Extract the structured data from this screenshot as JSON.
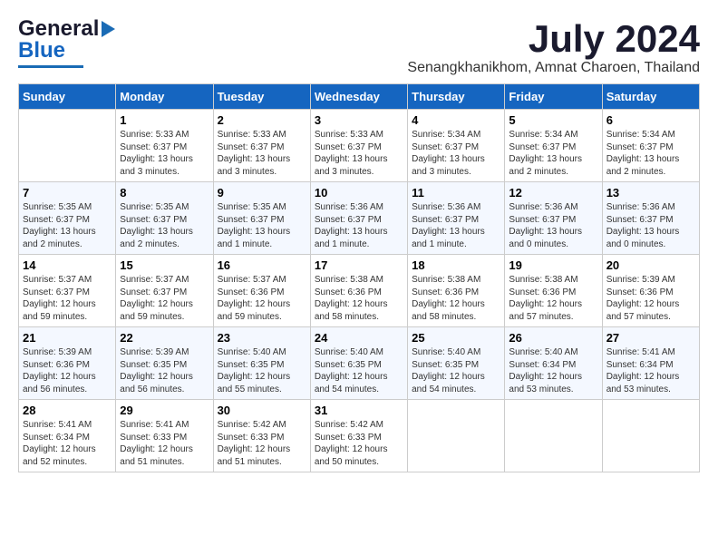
{
  "header": {
    "logo_line1": "General",
    "logo_line2": "Blue",
    "month": "July 2024",
    "location": "Senangkhanikhom, Amnat Charoen, Thailand"
  },
  "weekdays": [
    "Sunday",
    "Monday",
    "Tuesday",
    "Wednesday",
    "Thursday",
    "Friday",
    "Saturday"
  ],
  "weeks": [
    [
      {
        "day": "",
        "info": ""
      },
      {
        "day": "1",
        "info": "Sunrise: 5:33 AM\nSunset: 6:37 PM\nDaylight: 13 hours\nand 3 minutes."
      },
      {
        "day": "2",
        "info": "Sunrise: 5:33 AM\nSunset: 6:37 PM\nDaylight: 13 hours\nand 3 minutes."
      },
      {
        "day": "3",
        "info": "Sunrise: 5:33 AM\nSunset: 6:37 PM\nDaylight: 13 hours\nand 3 minutes."
      },
      {
        "day": "4",
        "info": "Sunrise: 5:34 AM\nSunset: 6:37 PM\nDaylight: 13 hours\nand 3 minutes."
      },
      {
        "day": "5",
        "info": "Sunrise: 5:34 AM\nSunset: 6:37 PM\nDaylight: 13 hours\nand 2 minutes."
      },
      {
        "day": "6",
        "info": "Sunrise: 5:34 AM\nSunset: 6:37 PM\nDaylight: 13 hours\nand 2 minutes."
      }
    ],
    [
      {
        "day": "7",
        "info": "Sunrise: 5:35 AM\nSunset: 6:37 PM\nDaylight: 13 hours\nand 2 minutes."
      },
      {
        "day": "8",
        "info": "Sunrise: 5:35 AM\nSunset: 6:37 PM\nDaylight: 13 hours\nand 2 minutes."
      },
      {
        "day": "9",
        "info": "Sunrise: 5:35 AM\nSunset: 6:37 PM\nDaylight: 13 hours\nand 1 minute."
      },
      {
        "day": "10",
        "info": "Sunrise: 5:36 AM\nSunset: 6:37 PM\nDaylight: 13 hours\nand 1 minute."
      },
      {
        "day": "11",
        "info": "Sunrise: 5:36 AM\nSunset: 6:37 PM\nDaylight: 13 hours\nand 1 minute."
      },
      {
        "day": "12",
        "info": "Sunrise: 5:36 AM\nSunset: 6:37 PM\nDaylight: 13 hours\nand 0 minutes."
      },
      {
        "day": "13",
        "info": "Sunrise: 5:36 AM\nSunset: 6:37 PM\nDaylight: 13 hours\nand 0 minutes."
      }
    ],
    [
      {
        "day": "14",
        "info": "Sunrise: 5:37 AM\nSunset: 6:37 PM\nDaylight: 12 hours\nand 59 minutes."
      },
      {
        "day": "15",
        "info": "Sunrise: 5:37 AM\nSunset: 6:37 PM\nDaylight: 12 hours\nand 59 minutes."
      },
      {
        "day": "16",
        "info": "Sunrise: 5:37 AM\nSunset: 6:36 PM\nDaylight: 12 hours\nand 59 minutes."
      },
      {
        "day": "17",
        "info": "Sunrise: 5:38 AM\nSunset: 6:36 PM\nDaylight: 12 hours\nand 58 minutes."
      },
      {
        "day": "18",
        "info": "Sunrise: 5:38 AM\nSunset: 6:36 PM\nDaylight: 12 hours\nand 58 minutes."
      },
      {
        "day": "19",
        "info": "Sunrise: 5:38 AM\nSunset: 6:36 PM\nDaylight: 12 hours\nand 57 minutes."
      },
      {
        "day": "20",
        "info": "Sunrise: 5:39 AM\nSunset: 6:36 PM\nDaylight: 12 hours\nand 57 minutes."
      }
    ],
    [
      {
        "day": "21",
        "info": "Sunrise: 5:39 AM\nSunset: 6:36 PM\nDaylight: 12 hours\nand 56 minutes."
      },
      {
        "day": "22",
        "info": "Sunrise: 5:39 AM\nSunset: 6:35 PM\nDaylight: 12 hours\nand 56 minutes."
      },
      {
        "day": "23",
        "info": "Sunrise: 5:40 AM\nSunset: 6:35 PM\nDaylight: 12 hours\nand 55 minutes."
      },
      {
        "day": "24",
        "info": "Sunrise: 5:40 AM\nSunset: 6:35 PM\nDaylight: 12 hours\nand 54 minutes."
      },
      {
        "day": "25",
        "info": "Sunrise: 5:40 AM\nSunset: 6:35 PM\nDaylight: 12 hours\nand 54 minutes."
      },
      {
        "day": "26",
        "info": "Sunrise: 5:40 AM\nSunset: 6:34 PM\nDaylight: 12 hours\nand 53 minutes."
      },
      {
        "day": "27",
        "info": "Sunrise: 5:41 AM\nSunset: 6:34 PM\nDaylight: 12 hours\nand 53 minutes."
      }
    ],
    [
      {
        "day": "28",
        "info": "Sunrise: 5:41 AM\nSunset: 6:34 PM\nDaylight: 12 hours\nand 52 minutes."
      },
      {
        "day": "29",
        "info": "Sunrise: 5:41 AM\nSunset: 6:33 PM\nDaylight: 12 hours\nand 51 minutes."
      },
      {
        "day": "30",
        "info": "Sunrise: 5:42 AM\nSunset: 6:33 PM\nDaylight: 12 hours\nand 51 minutes."
      },
      {
        "day": "31",
        "info": "Sunrise: 5:42 AM\nSunset: 6:33 PM\nDaylight: 12 hours\nand 50 minutes."
      },
      {
        "day": "",
        "info": ""
      },
      {
        "day": "",
        "info": ""
      },
      {
        "day": "",
        "info": ""
      }
    ]
  ]
}
